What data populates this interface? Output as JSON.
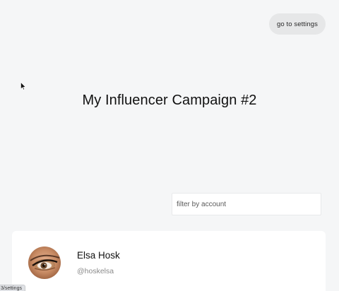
{
  "header": {
    "settings_button_label": "go to settings"
  },
  "main": {
    "title": "My Influencer Campaign #2",
    "filter": {
      "placeholder": "filter by account",
      "value": ""
    },
    "accounts": [
      {
        "name": "Elsa Hosk",
        "handle": "@hoskelsa",
        "avatar_icon": "avatar-photo-eye-makeup"
      }
    ]
  },
  "status_bar": {
    "link_url": "3/settings"
  }
}
